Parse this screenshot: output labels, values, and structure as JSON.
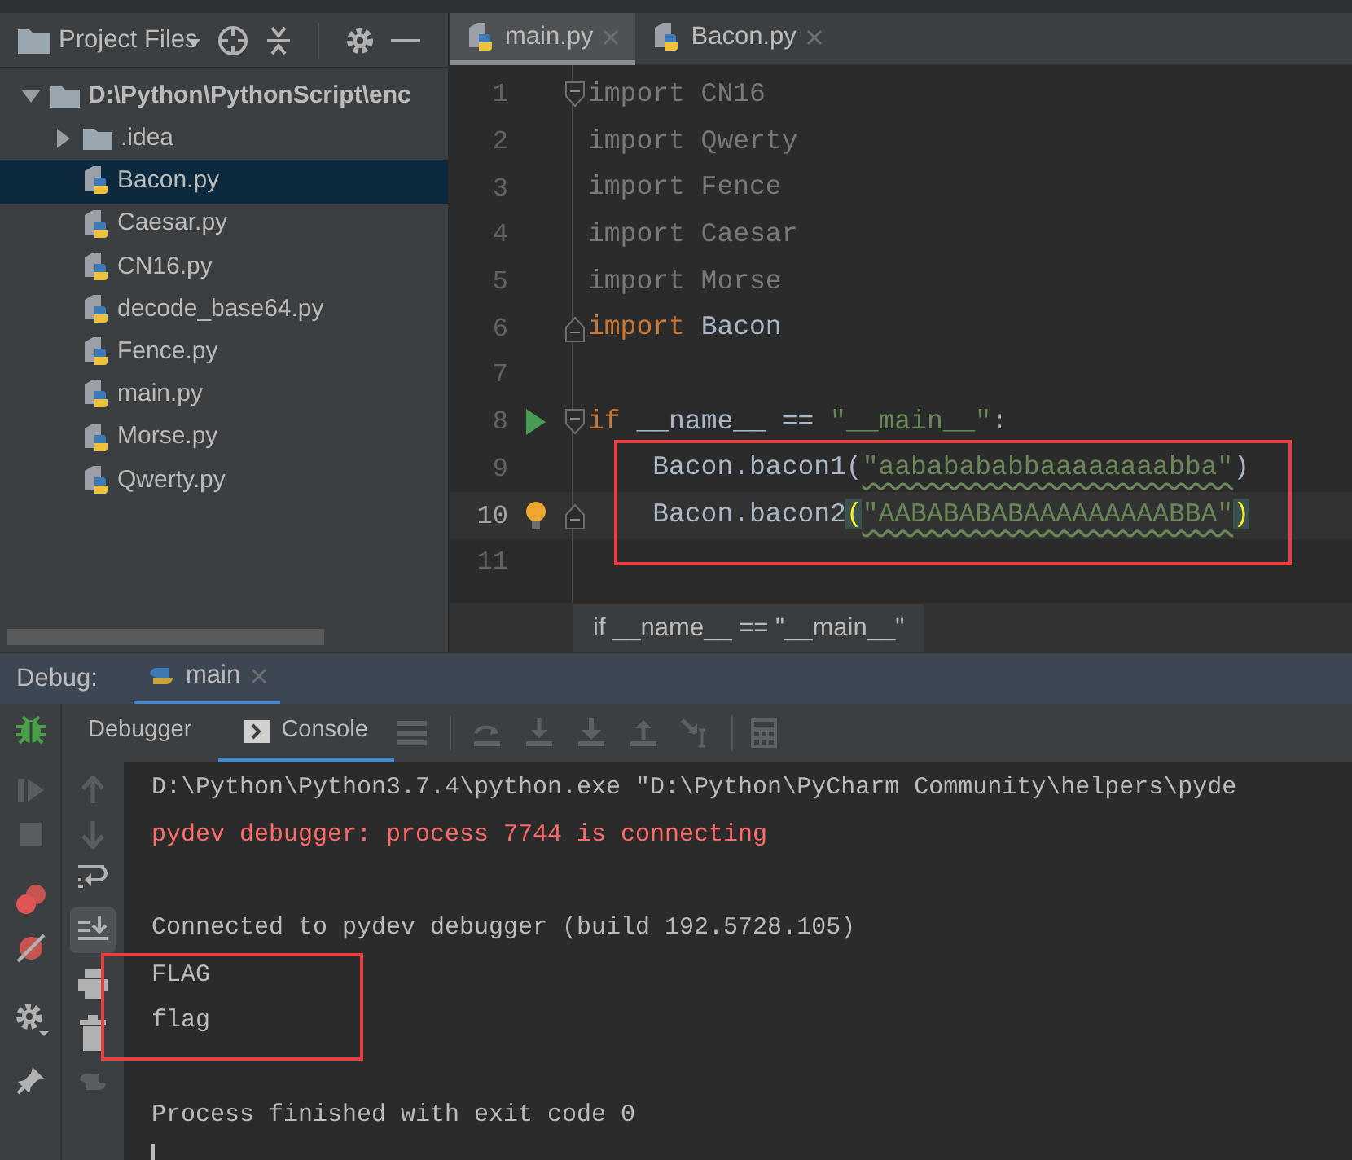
{
  "project": {
    "title": "Project Files",
    "tree": [
      {
        "label": "D:\\Python\\PythonScript\\enc",
        "kind": "folder",
        "expanded": true,
        "selected": false,
        "children": [
          {
            "label": ".idea",
            "kind": "folder",
            "expanded": false,
            "selected": false
          },
          {
            "label": "Bacon.py",
            "kind": "python",
            "selected": true
          },
          {
            "label": "Caesar.py",
            "kind": "python",
            "selected": false
          },
          {
            "label": "CN16.py",
            "kind": "python",
            "selected": false
          },
          {
            "label": "decode_base64.py",
            "kind": "python",
            "selected": false
          },
          {
            "label": "Fence.py",
            "kind": "python",
            "selected": false
          },
          {
            "label": "main.py",
            "kind": "python",
            "selected": false
          },
          {
            "label": "Morse.py",
            "kind": "python",
            "selected": false
          },
          {
            "label": "Qwerty.py",
            "kind": "python",
            "selected": false
          }
        ]
      }
    ]
  },
  "editor": {
    "tabs": [
      {
        "label": "main.py",
        "selected": true
      },
      {
        "label": "Bacon.py",
        "selected": false
      }
    ],
    "lines": [
      {
        "number": "1",
        "fold_start": true,
        "tokens": [
          {
            "text": "import CN16",
            "kind": "unused"
          }
        ]
      },
      {
        "number": "2",
        "tokens": [
          {
            "text": "import Qwerty",
            "kind": "unused"
          }
        ]
      },
      {
        "number": "3",
        "tokens": [
          {
            "text": "import Fence",
            "kind": "unused"
          }
        ]
      },
      {
        "number": "4",
        "tokens": [
          {
            "text": "import Caesar",
            "kind": "unused"
          }
        ]
      },
      {
        "number": "5",
        "tokens": [
          {
            "text": "import Morse",
            "kind": "unused"
          }
        ]
      },
      {
        "number": "6",
        "fold_end": true,
        "tokens": [
          {
            "text": "import",
            "kind": "keyword"
          },
          {
            "text": " Bacon",
            "kind": "plain"
          }
        ]
      },
      {
        "number": "7"
      },
      {
        "number": "8",
        "fold_start": true,
        "run": true,
        "tokens": [
          {
            "text": "if",
            "kind": "keyword"
          },
          {
            "text": " __name__ == ",
            "kind": "plain"
          },
          {
            "text": "\"__main__\"",
            "kind": "string"
          },
          {
            "text": ":",
            "kind": "plain"
          }
        ]
      },
      {
        "number": "9",
        "tokens": [
          {
            "text": "    Bacon.bacon1(",
            "kind": "plain"
          },
          {
            "text": "\"aababababbaaaaaaaabba\"",
            "kind": "string",
            "typo": true
          },
          {
            "text": ")",
            "kind": "plain"
          }
        ]
      },
      {
        "number": "10",
        "fold_end": true,
        "bulb": true,
        "current": true,
        "tokens": [
          {
            "text": "    Bacon.bacon2",
            "kind": "plain"
          },
          {
            "text": "(",
            "kind": "brace-match"
          },
          {
            "text": "\"AABABABABAAAAAAAAABBA\"",
            "kind": "string",
            "typo": true
          },
          {
            "text": ")",
            "kind": "brace-match"
          }
        ]
      },
      {
        "number": "11"
      }
    ],
    "breadcrumb": "if __name__ == \"__main__\""
  },
  "debug": {
    "label": "Debug:",
    "session": {
      "label": "main",
      "selected": true
    },
    "tabs": [
      {
        "label": "Debugger",
        "selected": false
      },
      {
        "label": "Console",
        "selected": true
      }
    ],
    "console": {
      "caret": true,
      "lines": [
        {
          "kind": "command",
          "text": "D:\\Python\\Python3.7.4\\python.exe \"D:\\Python\\PyCharm Community\\helpers\\pyde"
        },
        {
          "kind": "error",
          "text": "pydev debugger: process 7744 is connecting"
        },
        {
          "kind": "blank"
        },
        {
          "kind": "output",
          "text": "Connected to pydev debugger (build 192.5728.105)"
        },
        {
          "kind": "output",
          "text": "FLAG"
        },
        {
          "kind": "output",
          "text": "flag"
        },
        {
          "kind": "blank"
        },
        {
          "kind": "output",
          "text": "Process finished with exit code 0"
        }
      ]
    }
  }
}
